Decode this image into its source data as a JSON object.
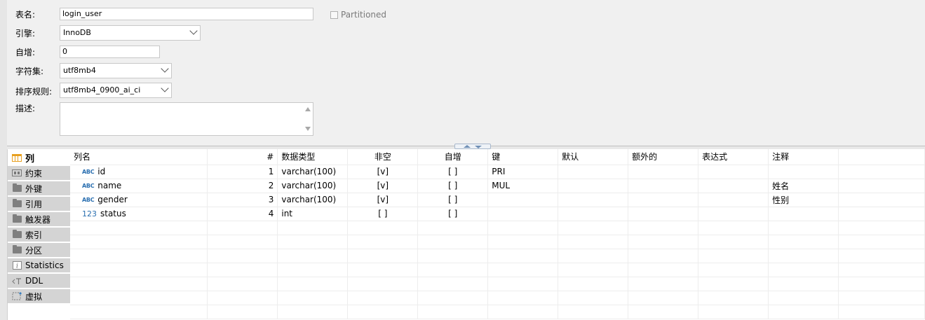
{
  "properties": {
    "table_name_label": "表名:",
    "table_name_value": "login_user",
    "partitioned_label": "Partitioned",
    "engine_label": "引擎:",
    "engine_value": "InnoDB",
    "auto_increment_label": "自增:",
    "auto_increment_value": "0",
    "charset_label": "字符集:",
    "charset_value": "utf8mb4",
    "collation_label": "排序规则:",
    "collation_value": "utf8mb4_0900_ai_ci",
    "description_label": "描述:"
  },
  "tabs": [
    {
      "label": "列",
      "icon": "columns-icon",
      "active": true
    },
    {
      "label": "约束",
      "icon": "constraints-icon"
    },
    {
      "label": "外键",
      "icon": "folder-icon"
    },
    {
      "label": "引用",
      "icon": "folder-icon"
    },
    {
      "label": "触发器",
      "icon": "folder-icon"
    },
    {
      "label": "索引",
      "icon": "folder-icon"
    },
    {
      "label": "分区",
      "icon": "folder-icon"
    },
    {
      "label": "Statistics",
      "icon": "info-icon"
    },
    {
      "label": "DDL",
      "icon": "ddl-icon"
    },
    {
      "label": "虚拟",
      "icon": "virtual-icon"
    }
  ],
  "grid": {
    "headers": [
      "列名",
      "#",
      "数据类型",
      "非空",
      "自增",
      "键",
      "默认",
      "额外的",
      "表达式",
      "注释"
    ],
    "rows": [
      {
        "icon": "ABC",
        "name": "id",
        "num": "1",
        "type": "varchar(100)",
        "not_null": "[v]",
        "auto_inc": "[ ]",
        "key": "PRI",
        "default": "",
        "extra": "",
        "expr": "",
        "comment": ""
      },
      {
        "icon": "ABC",
        "name": "name",
        "num": "2",
        "type": "varchar(100)",
        "not_null": "[v]",
        "auto_inc": "[ ]",
        "key": "MUL",
        "default": "",
        "extra": "",
        "expr": "",
        "comment": "姓名"
      },
      {
        "icon": "ABC",
        "name": "gender",
        "num": "3",
        "type": "varchar(100)",
        "not_null": "[v]",
        "auto_inc": "[ ]",
        "key": "",
        "default": "",
        "extra": "",
        "expr": "",
        "comment": "性别"
      },
      {
        "icon": "123",
        "name": "status",
        "num": "4",
        "type": "int",
        "not_null": "[ ]",
        "auto_inc": "[ ]",
        "key": "",
        "default": "",
        "extra": "",
        "expr": "",
        "comment": ""
      }
    ]
  }
}
